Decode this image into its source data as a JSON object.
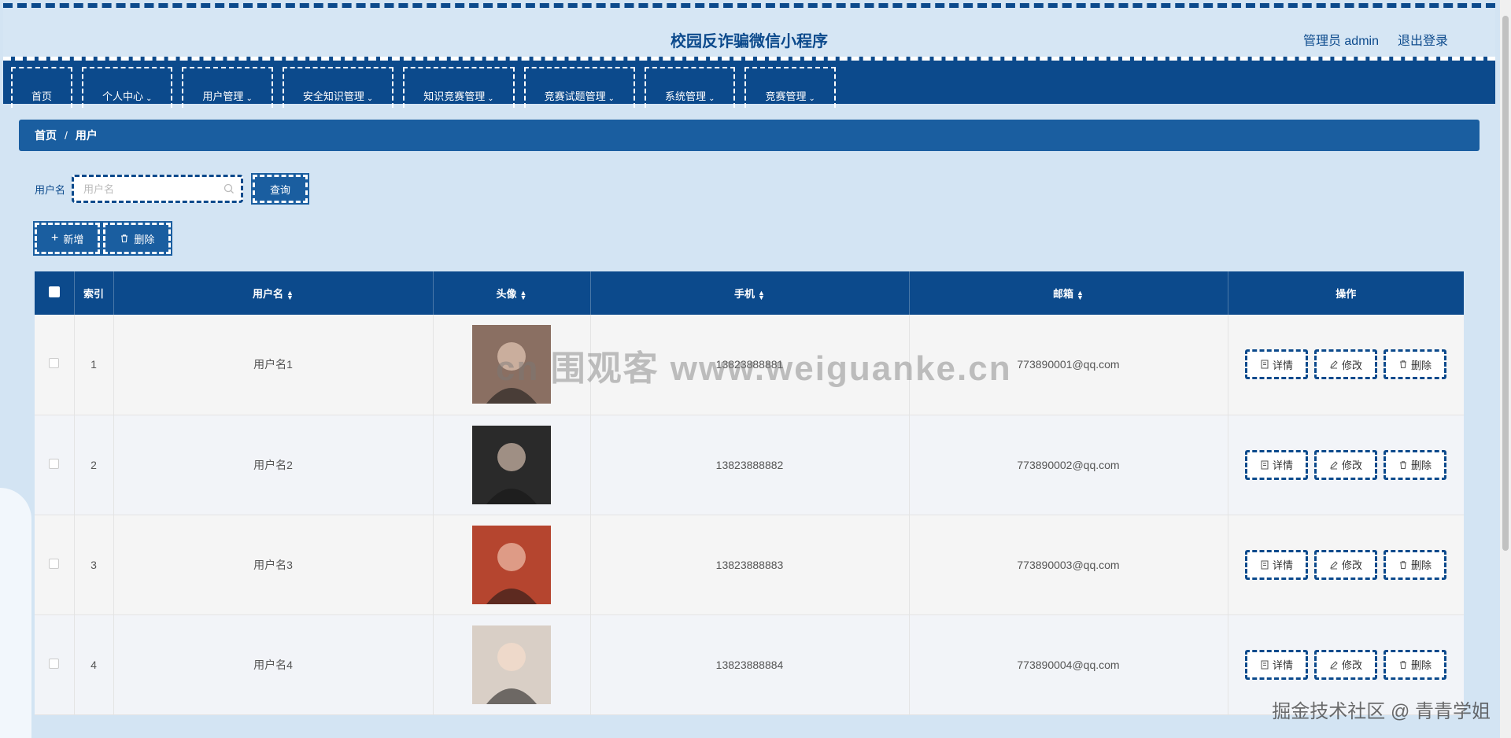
{
  "header": {
    "title": "校园反诈骗微信小程序",
    "user_label": "管理员 admin",
    "logout_label": "退出登录"
  },
  "nav": {
    "items": [
      {
        "label": "首页",
        "has_dropdown": false
      },
      {
        "label": "个人中心",
        "has_dropdown": true
      },
      {
        "label": "用户管理",
        "has_dropdown": true
      },
      {
        "label": "安全知识管理",
        "has_dropdown": true
      },
      {
        "label": "知识竞赛管理",
        "has_dropdown": true
      },
      {
        "label": "竞赛试题管理",
        "has_dropdown": true
      },
      {
        "label": "系统管理",
        "has_dropdown": true
      },
      {
        "label": "竞赛管理",
        "has_dropdown": true
      }
    ]
  },
  "breadcrumb": {
    "home": "首页",
    "separator": "/",
    "current": "用户"
  },
  "search": {
    "label": "用户名",
    "placeholder": "用户名",
    "value": "",
    "query_label": "查询"
  },
  "actions": {
    "add_label": "新增",
    "delete_label": "删除"
  },
  "table": {
    "columns": {
      "index": "索引",
      "username": "用户名",
      "avatar": "头像",
      "phone": "手机",
      "email": "邮箱",
      "ops": "操作"
    },
    "rows": [
      {
        "index": "1",
        "username": "用户名1",
        "phone": "13823888881",
        "email": "773890001@qq.com",
        "avatar_color": "#8a6f62"
      },
      {
        "index": "2",
        "username": "用户名2",
        "phone": "13823888882",
        "email": "773890002@qq.com",
        "avatar_color": "#2a2a2a"
      },
      {
        "index": "3",
        "username": "用户名3",
        "phone": "13823888883",
        "email": "773890003@qq.com",
        "avatar_color": "#b5452f"
      },
      {
        "index": "4",
        "username": "用户名4",
        "phone": "13823888884",
        "email": "773890004@qq.com",
        "avatar_color": "#d9cfc6"
      }
    ],
    "row_actions": {
      "detail": "详情",
      "edit": "修改",
      "delete": "删除"
    }
  },
  "watermarks": {
    "center": "cn 围观客 www.weiguanke.cn",
    "bottom": "掘金技术社区 @ 青青学姐"
  },
  "colors": {
    "primary": "#0c4a8c",
    "accent": "#1a5ea0",
    "background": "#d3e4f3"
  }
}
